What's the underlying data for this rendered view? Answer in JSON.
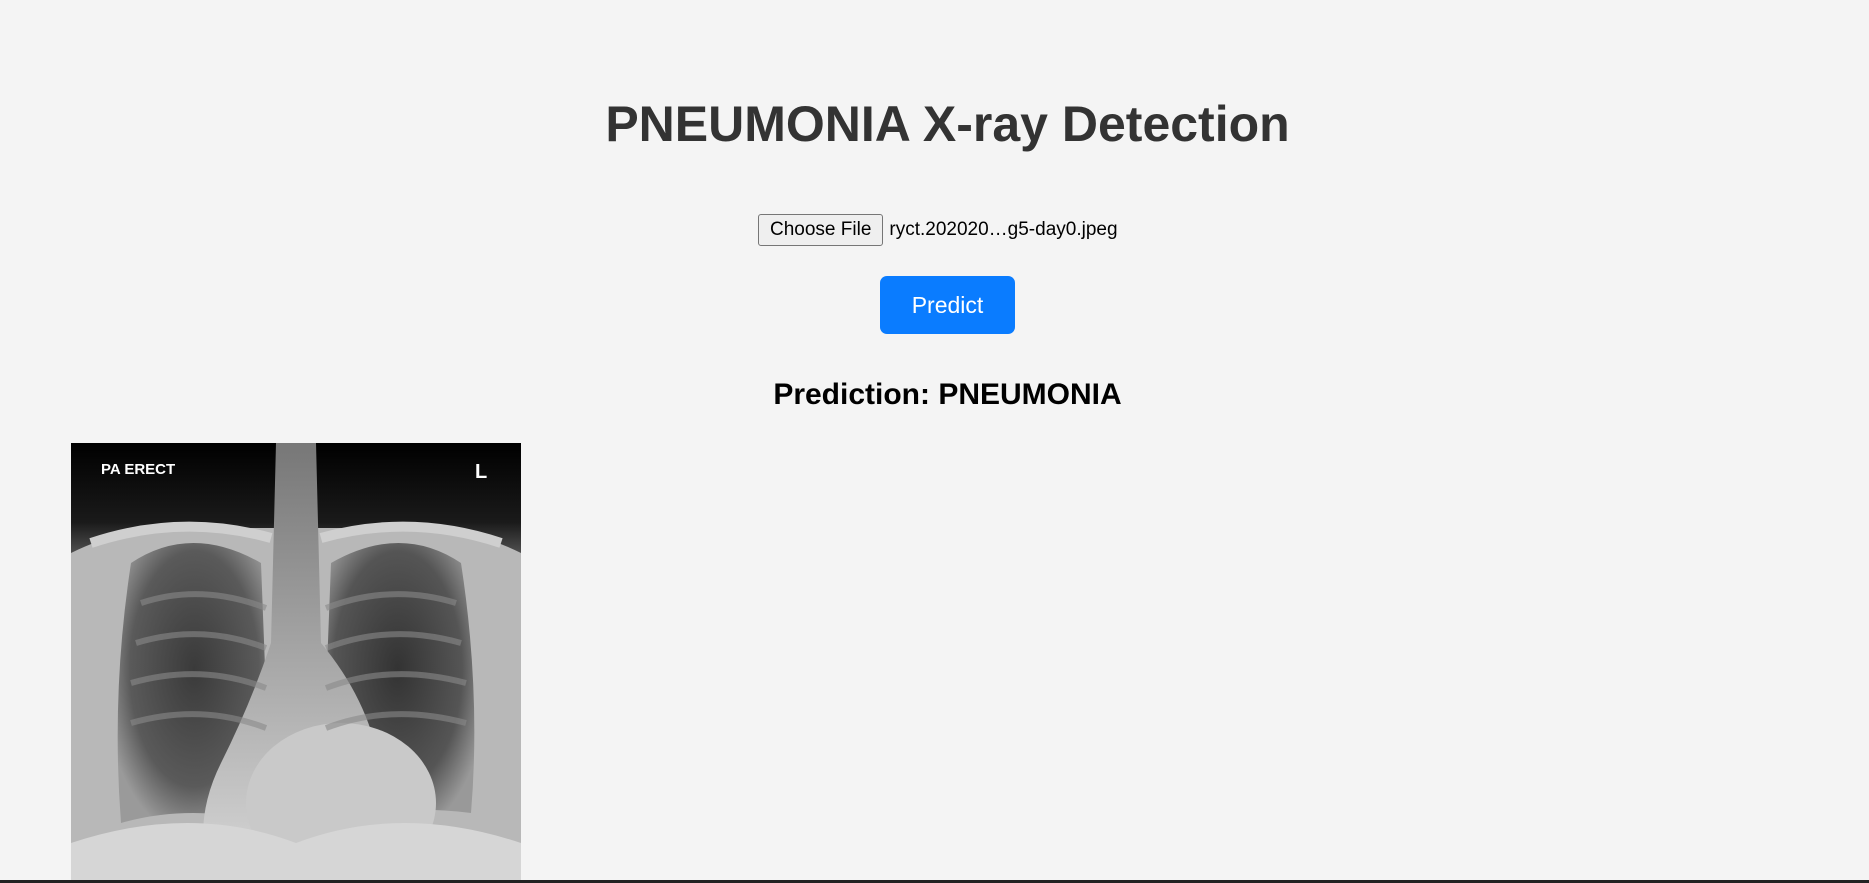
{
  "page": {
    "title": "PNEUMONIA X-ray Detection"
  },
  "upload": {
    "choose_label": "Choose File",
    "file_name": "ryct.202020…g5-day0.jpeg"
  },
  "actions": {
    "predict_label": "Predict"
  },
  "result": {
    "prediction_text": "Prediction: PNEUMONIA"
  },
  "xray_image": {
    "view_label": "PA ERECT",
    "side_marker": "L"
  },
  "colors": {
    "background": "#f4f4f4",
    "accent": "#0a7cff",
    "title": "#333333"
  }
}
